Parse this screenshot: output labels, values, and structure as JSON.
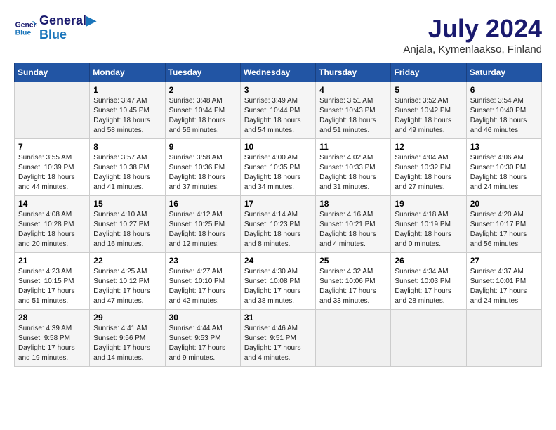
{
  "header": {
    "logo_line1": "General",
    "logo_line2": "Blue",
    "month_year": "July 2024",
    "location": "Anjala, Kymenlaakso, Finland"
  },
  "weekdays": [
    "Sunday",
    "Monday",
    "Tuesday",
    "Wednesday",
    "Thursday",
    "Friday",
    "Saturday"
  ],
  "weeks": [
    [
      {
        "day": "",
        "info": ""
      },
      {
        "day": "1",
        "info": "Sunrise: 3:47 AM\nSunset: 10:45 PM\nDaylight: 18 hours\nand 58 minutes."
      },
      {
        "day": "2",
        "info": "Sunrise: 3:48 AM\nSunset: 10:44 PM\nDaylight: 18 hours\nand 56 minutes."
      },
      {
        "day": "3",
        "info": "Sunrise: 3:49 AM\nSunset: 10:44 PM\nDaylight: 18 hours\nand 54 minutes."
      },
      {
        "day": "4",
        "info": "Sunrise: 3:51 AM\nSunset: 10:43 PM\nDaylight: 18 hours\nand 51 minutes."
      },
      {
        "day": "5",
        "info": "Sunrise: 3:52 AM\nSunset: 10:42 PM\nDaylight: 18 hours\nand 49 minutes."
      },
      {
        "day": "6",
        "info": "Sunrise: 3:54 AM\nSunset: 10:40 PM\nDaylight: 18 hours\nand 46 minutes."
      }
    ],
    [
      {
        "day": "7",
        "info": "Sunrise: 3:55 AM\nSunset: 10:39 PM\nDaylight: 18 hours\nand 44 minutes."
      },
      {
        "day": "8",
        "info": "Sunrise: 3:57 AM\nSunset: 10:38 PM\nDaylight: 18 hours\nand 41 minutes."
      },
      {
        "day": "9",
        "info": "Sunrise: 3:58 AM\nSunset: 10:36 PM\nDaylight: 18 hours\nand 37 minutes."
      },
      {
        "day": "10",
        "info": "Sunrise: 4:00 AM\nSunset: 10:35 PM\nDaylight: 18 hours\nand 34 minutes."
      },
      {
        "day": "11",
        "info": "Sunrise: 4:02 AM\nSunset: 10:33 PM\nDaylight: 18 hours\nand 31 minutes."
      },
      {
        "day": "12",
        "info": "Sunrise: 4:04 AM\nSunset: 10:32 PM\nDaylight: 18 hours\nand 27 minutes."
      },
      {
        "day": "13",
        "info": "Sunrise: 4:06 AM\nSunset: 10:30 PM\nDaylight: 18 hours\nand 24 minutes."
      }
    ],
    [
      {
        "day": "14",
        "info": "Sunrise: 4:08 AM\nSunset: 10:28 PM\nDaylight: 18 hours\nand 20 minutes."
      },
      {
        "day": "15",
        "info": "Sunrise: 4:10 AM\nSunset: 10:27 PM\nDaylight: 18 hours\nand 16 minutes."
      },
      {
        "day": "16",
        "info": "Sunrise: 4:12 AM\nSunset: 10:25 PM\nDaylight: 18 hours\nand 12 minutes."
      },
      {
        "day": "17",
        "info": "Sunrise: 4:14 AM\nSunset: 10:23 PM\nDaylight: 18 hours\nand 8 minutes."
      },
      {
        "day": "18",
        "info": "Sunrise: 4:16 AM\nSunset: 10:21 PM\nDaylight: 18 hours\nand 4 minutes."
      },
      {
        "day": "19",
        "info": "Sunrise: 4:18 AM\nSunset: 10:19 PM\nDaylight: 18 hours\nand 0 minutes."
      },
      {
        "day": "20",
        "info": "Sunrise: 4:20 AM\nSunset: 10:17 PM\nDaylight: 17 hours\nand 56 minutes."
      }
    ],
    [
      {
        "day": "21",
        "info": "Sunrise: 4:23 AM\nSunset: 10:15 PM\nDaylight: 17 hours\nand 51 minutes."
      },
      {
        "day": "22",
        "info": "Sunrise: 4:25 AM\nSunset: 10:12 PM\nDaylight: 17 hours\nand 47 minutes."
      },
      {
        "day": "23",
        "info": "Sunrise: 4:27 AM\nSunset: 10:10 PM\nDaylight: 17 hours\nand 42 minutes."
      },
      {
        "day": "24",
        "info": "Sunrise: 4:30 AM\nSunset: 10:08 PM\nDaylight: 17 hours\nand 38 minutes."
      },
      {
        "day": "25",
        "info": "Sunrise: 4:32 AM\nSunset: 10:06 PM\nDaylight: 17 hours\nand 33 minutes."
      },
      {
        "day": "26",
        "info": "Sunrise: 4:34 AM\nSunset: 10:03 PM\nDaylight: 17 hours\nand 28 minutes."
      },
      {
        "day": "27",
        "info": "Sunrise: 4:37 AM\nSunset: 10:01 PM\nDaylight: 17 hours\nand 24 minutes."
      }
    ],
    [
      {
        "day": "28",
        "info": "Sunrise: 4:39 AM\nSunset: 9:58 PM\nDaylight: 17 hours\nand 19 minutes."
      },
      {
        "day": "29",
        "info": "Sunrise: 4:41 AM\nSunset: 9:56 PM\nDaylight: 17 hours\nand 14 minutes."
      },
      {
        "day": "30",
        "info": "Sunrise: 4:44 AM\nSunset: 9:53 PM\nDaylight: 17 hours\nand 9 minutes."
      },
      {
        "day": "31",
        "info": "Sunrise: 4:46 AM\nSunset: 9:51 PM\nDaylight: 17 hours\nand 4 minutes."
      },
      {
        "day": "",
        "info": ""
      },
      {
        "day": "",
        "info": ""
      },
      {
        "day": "",
        "info": ""
      }
    ]
  ]
}
